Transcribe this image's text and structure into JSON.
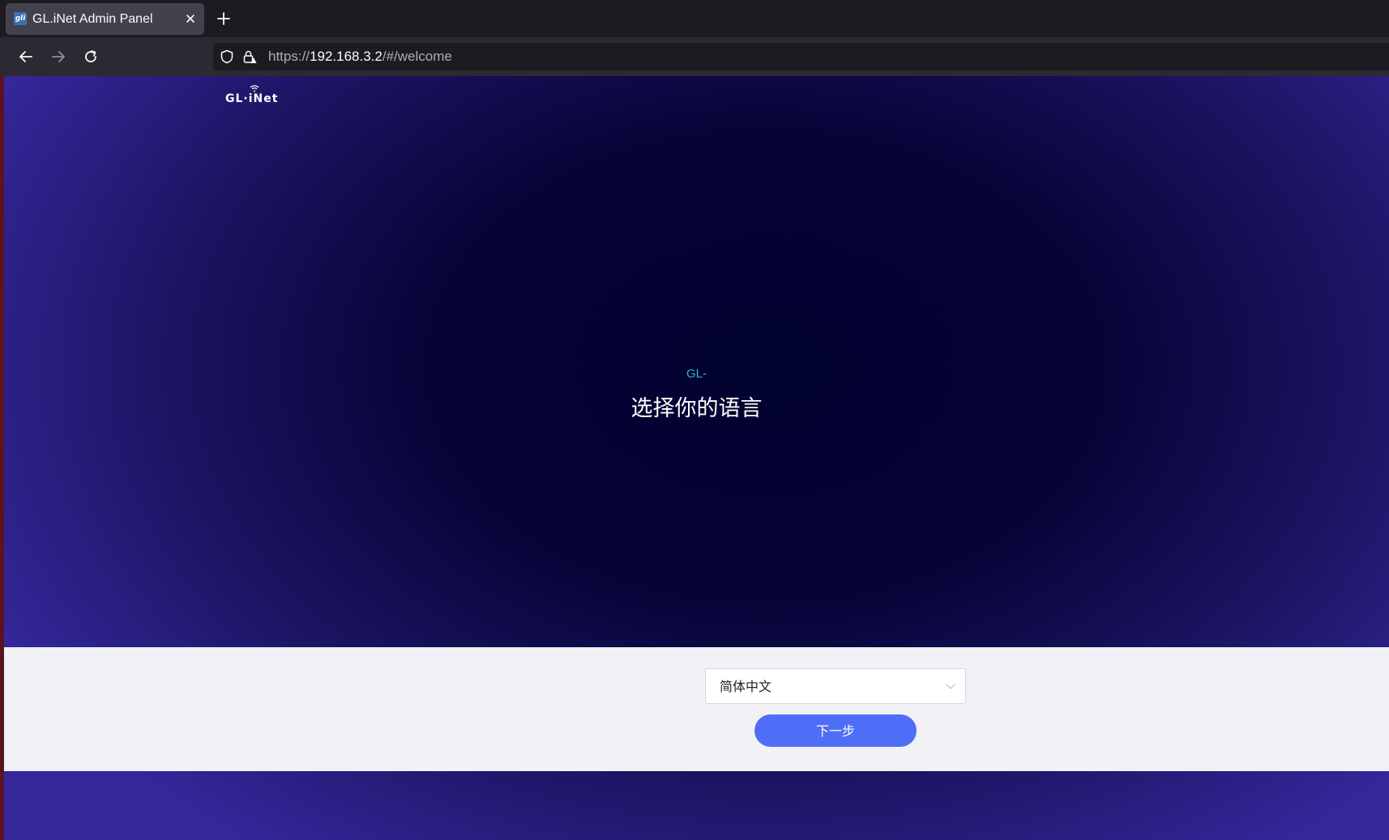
{
  "browser": {
    "tab_title": "GL.iNet Admin Panel",
    "favicon_text": "gli",
    "url_scheme": "https://",
    "url_host": "192.168.3.2",
    "url_path": "/#/welcome",
    "icons": {
      "back": "arrow-left-icon",
      "forward": "arrow-right-icon",
      "reload": "reload-icon",
      "tracking": "shield-icon",
      "lock": "lock-warning-icon",
      "close_tab": "close-icon",
      "new_tab": "plus-icon"
    }
  },
  "page": {
    "logo_text": "GL·iNet",
    "model_text": "GL-",
    "heading": "选择你的语言",
    "language_select": {
      "selected": "简体中文"
    },
    "next_button": "下一步"
  },
  "colors": {
    "accent_button": "#4f6ef7",
    "model_text": "#2fb8c8",
    "panel_bg": "#f2f2f6",
    "page_dark": "#020230",
    "page_light": "#34279a"
  }
}
